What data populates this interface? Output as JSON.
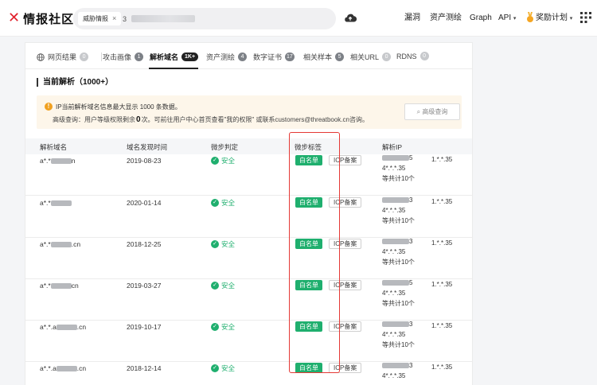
{
  "brand": {
    "name": "情报社区",
    "accent": "#e0202b"
  },
  "search": {
    "tag_label": "威胁情报",
    "value": "3"
  },
  "nav": {
    "items": [
      "漏洞",
      "资产测绘",
      "Graph",
      "API",
      "奖励计划"
    ]
  },
  "tabs": [
    {
      "label": "网页结果",
      "count": "0"
    },
    {
      "label": "攻击画像",
      "count": "1"
    },
    {
      "label": "解析域名",
      "count": "1K+",
      "active": true
    },
    {
      "label": "资产测绘",
      "count": "4"
    },
    {
      "label": "数字证书",
      "count": "17"
    },
    {
      "label": "相关样本",
      "count": "5"
    },
    {
      "label": "相关URL",
      "count": "0"
    },
    {
      "label": "RDNS",
      "count": "0"
    }
  ],
  "section": {
    "title": "当前解析（1000+）"
  },
  "notice": {
    "line1": "IP当前解析域名信息最大显示 1000 条数据。",
    "line2_prefix": "高级查询：用户等级权限剩余",
    "line2_count": "0",
    "line2_suffix": "次。可前往用户中心首页查看\"我的权限\" 或联系customers@threatbook.cn咨询。",
    "button": "高级查询"
  },
  "table": {
    "headers": [
      "解析域名",
      "域名发现时间",
      "微步判定",
      "微步标签",
      "解析IP"
    ],
    "rows": [
      {
        "domain_a": "a*.*",
        "domain_b": "n",
        "date": "2019-08-23",
        "verdict": "安全",
        "tag1": "白名单",
        "tag2": "ICP备案",
        "ip1_tail": "5",
        "ip2": "4*.*.*.35",
        "ip_right": "1.*.*.35",
        "total": "等共计10个"
      },
      {
        "domain_a": "a*.*",
        "domain_b": "",
        "date": "2020-01-14",
        "verdict": "安全",
        "tag1": "白名单",
        "tag2": "ICP备案",
        "ip1_tail": "3",
        "ip2": "4*.*.*.35",
        "ip_right": "1.*.*.35",
        "total": "等共计10个"
      },
      {
        "domain_a": "a*.*",
        "domain_b": ".cn",
        "date": "2018-12-25",
        "verdict": "安全",
        "tag1": "白名单",
        "tag2": "ICP备案",
        "ip1_tail": "3",
        "ip2": "4*.*.*.35",
        "ip_right": "1.*.*.35",
        "total": "等共计10个"
      },
      {
        "domain_a": "a*.*",
        "domain_b": "cn",
        "date": "2019-03-27",
        "verdict": "安全",
        "tag1": "白名单",
        "tag2": "ICP备案",
        "ip1_tail": "5",
        "ip2": "4*.*.*.35",
        "ip_right": "1.*.*.35",
        "total": "等共计10个"
      },
      {
        "domain_a": "a*.*.a",
        "domain_b": ".cn",
        "date": "2019-10-17",
        "verdict": "安全",
        "tag1": "白名单",
        "tag2": "ICP备案",
        "ip1_tail": "3",
        "ip2": "4*.*.*.35",
        "ip_right": "1.*.*.35",
        "total": "等共计10个"
      },
      {
        "domain_a": "a*.*.a",
        "domain_b": ".cn",
        "date": "2018-12-14",
        "verdict": "安全",
        "tag1": "白名单",
        "tag2": "ICP备案",
        "ip1_tail": "3",
        "ip2": "4*.*.*.35",
        "ip_right": "1.*.*.35",
        "total": ""
      }
    ]
  },
  "icons": {
    "cloud": "cloud-icon",
    "grid": "grid-icon",
    "medal": "medal-icon",
    "globe": "globe-icon",
    "search": "search-icon",
    "warning": "warning-icon",
    "check": "check-icon"
  },
  "colors": {
    "safe": "#1faf6e",
    "highlight": "#e53935",
    "notice_bg": "#fdf6ea"
  }
}
